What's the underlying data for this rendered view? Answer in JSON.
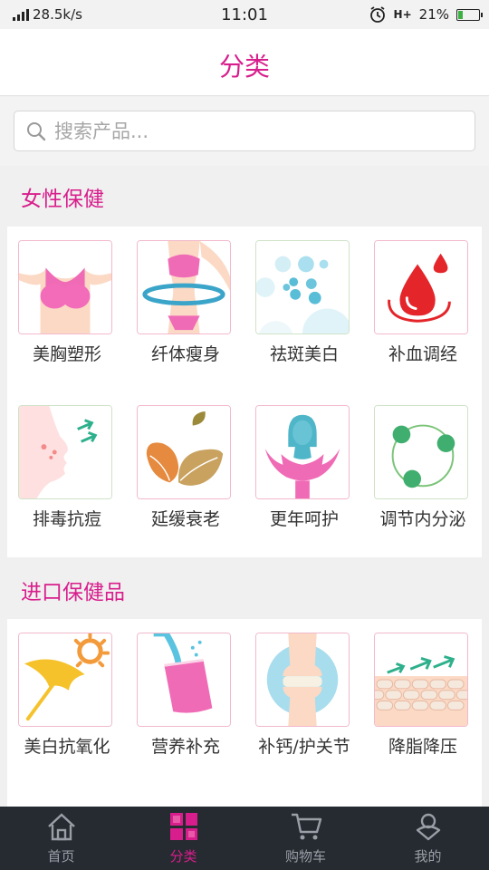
{
  "status_bar": {
    "net_speed": "28.5k/s",
    "time": "11:01",
    "network_type": "H+",
    "battery": "21%"
  },
  "header": {
    "title": "分类"
  },
  "search": {
    "placeholder": "搜索产品..."
  },
  "sections": [
    {
      "title": "女性保健",
      "items": [
        {
          "label": "美胸塑形",
          "icon": "bust-icon"
        },
        {
          "label": "纤体瘦身",
          "icon": "slim-body-icon"
        },
        {
          "label": "祛斑美白",
          "icon": "spots-icon"
        },
        {
          "label": "补血调经",
          "icon": "blood-drop-icon"
        },
        {
          "label": "排毒抗痘",
          "icon": "face-detox-icon"
        },
        {
          "label": "延缓衰老",
          "icon": "leaves-icon"
        },
        {
          "label": "更年呵护",
          "icon": "woman-hands-icon"
        },
        {
          "label": "调节内分泌",
          "icon": "cycle-icon"
        }
      ]
    },
    {
      "title": "进口保健品",
      "items": [
        {
          "label": "美白抗氧化",
          "icon": "sun-umbrella-icon"
        },
        {
          "label": "营养补充",
          "icon": "drink-cup-icon"
        },
        {
          "label": "补钙/护关节",
          "icon": "joint-icon"
        },
        {
          "label": "降脂降压",
          "icon": "fat-arrows-icon"
        }
      ]
    }
  ],
  "tabbar": {
    "items": [
      {
        "label": "首页",
        "icon": "home-icon",
        "active": false
      },
      {
        "label": "分类",
        "icon": "category-icon",
        "active": true
      },
      {
        "label": "购物车",
        "icon": "cart-icon",
        "active": false
      },
      {
        "label": "我的",
        "icon": "profile-icon",
        "active": false
      }
    ]
  },
  "colors": {
    "accent": "#d81e8c",
    "tabbar_bg": "#262a31",
    "tab_inactive": "#9a9ea6"
  }
}
